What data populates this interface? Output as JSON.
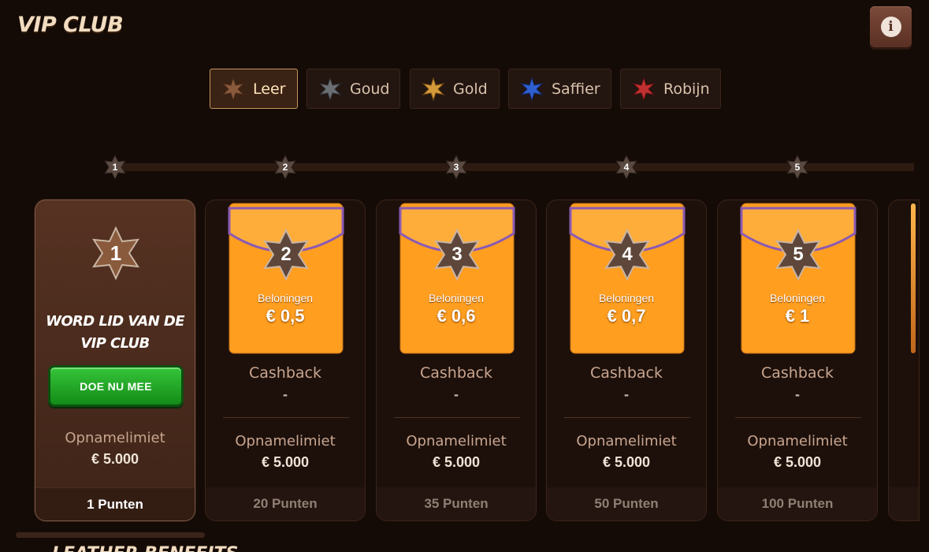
{
  "header": {
    "title": "VIP CLUB",
    "info_icon": "info-icon",
    "info_glyph": "i"
  },
  "tabs": [
    {
      "label": "Leer",
      "color": "#8a5a3c",
      "active": true
    },
    {
      "label": "Goud",
      "color": "#6b6f73",
      "active": false
    },
    {
      "label": "Gold",
      "color": "#d49a3a",
      "active": false
    },
    {
      "label": "Saffier",
      "color": "#2f5fd0",
      "active": false
    },
    {
      "label": "Robijn",
      "color": "#c03030",
      "active": false
    }
  ],
  "levels": [
    "1",
    "2",
    "3",
    "4",
    "5"
  ],
  "first_card": {
    "level": "1",
    "join_line1": "WORD LID VAN DE",
    "join_line2": "VIP CLUB",
    "button": "DOE NU MEE",
    "limit_label": "Opnamelimiet",
    "limit_value": "€ 5.000",
    "points": "1 Punten"
  },
  "cards": [
    {
      "level": "2",
      "reward_label": "Beloningen",
      "reward_value": "€ 0,5",
      "cashback_label": "Cashback",
      "cashback_value": "-",
      "limit_label": "Opnamelimiet",
      "limit_value": "€ 5.000",
      "points": "20 Punten"
    },
    {
      "level": "3",
      "reward_label": "Beloningen",
      "reward_value": "€ 0,6",
      "cashback_label": "Cashback",
      "cashback_value": "-",
      "limit_label": "Opnamelimiet",
      "limit_value": "€ 5.000",
      "points": "35 Punten"
    },
    {
      "level": "4",
      "reward_label": "Beloningen",
      "reward_value": "€ 0,7",
      "cashback_label": "Cashback",
      "cashback_value": "-",
      "limit_label": "Opnamelimiet",
      "limit_value": "€ 5.000",
      "points": "50 Punten"
    },
    {
      "level": "5",
      "reward_label": "Beloningen",
      "reward_value": "€ 1",
      "cashback_label": "Cashback",
      "cashback_value": "-",
      "limit_label": "Opnamelimiet",
      "limit_value": "€ 5.000",
      "points": "100 Punten"
    }
  ],
  "section_title": "LEATHER BENEFITS",
  "colors": {
    "accent": "#c6935e",
    "background": "#150b06",
    "join_green": "#22a826",
    "envelope": "#ff9e1f"
  }
}
